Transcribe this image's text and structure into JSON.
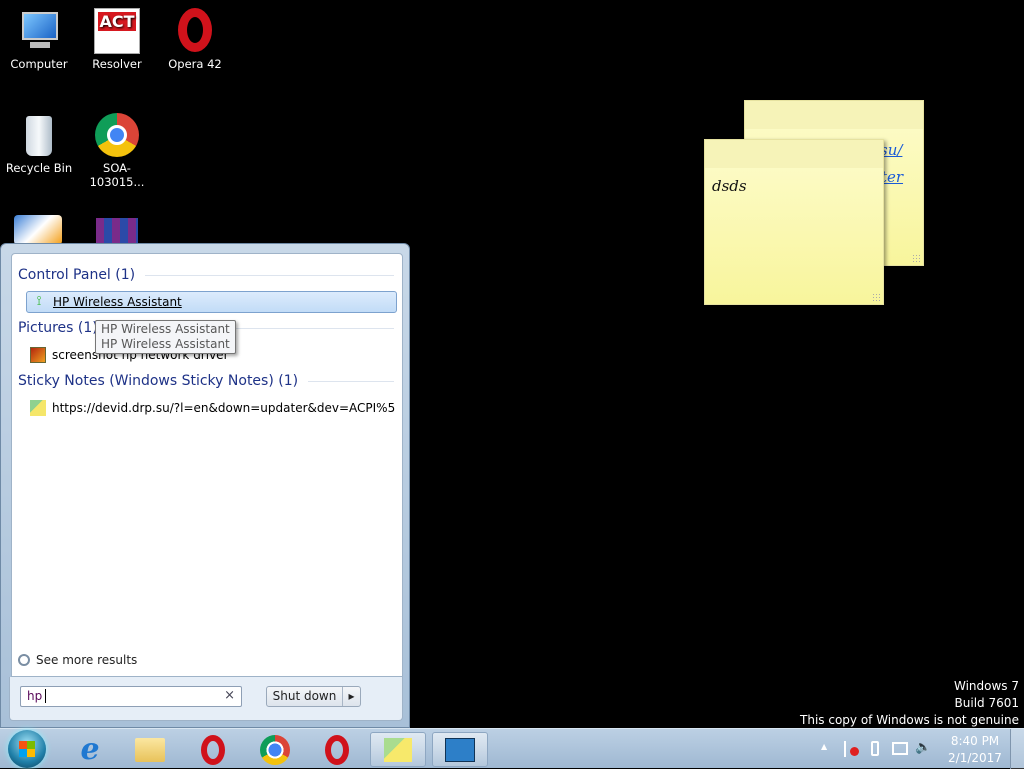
{
  "desktop": {
    "icons": [
      {
        "label": "Computer"
      },
      {
        "label": "Resolver"
      },
      {
        "label": "Opera 42"
      },
      {
        "label": "Recycle Bin"
      },
      {
        "label": "SOA-103015..."
      }
    ]
  },
  "sticky_notes": [
    {
      "text_fragments": [
        "su/",
        "ater"
      ]
    },
    {
      "text": "dsds"
    }
  ],
  "start_menu": {
    "groups": [
      {
        "title": "Control Panel (1)",
        "items": [
          "HP Wireless Assistant"
        ]
      },
      {
        "title": "Pictures (1)",
        "items": [
          "screenshot hp network driver"
        ]
      },
      {
        "title": "Sticky Notes (Windows Sticky Notes) (1)",
        "items": [
          "https://devid.drp.su/?l=en&down=updater&dev=ACPI%5"
        ]
      }
    ],
    "tooltip": [
      "HP Wireless Assistant",
      "HP Wireless Assistant"
    ],
    "see_more": "See more results",
    "search_value": "hp",
    "clear": "×",
    "shutdown": "Shut down",
    "shutdown_arrow": "▸"
  },
  "watermark": {
    "line1": "Windows 7",
    "line2": "Build 7601",
    "line3": "This copy of Windows is not genuine"
  },
  "tray": {
    "time": "8:40 PM",
    "date": "2/1/2017",
    "show_hidden": "▲"
  }
}
